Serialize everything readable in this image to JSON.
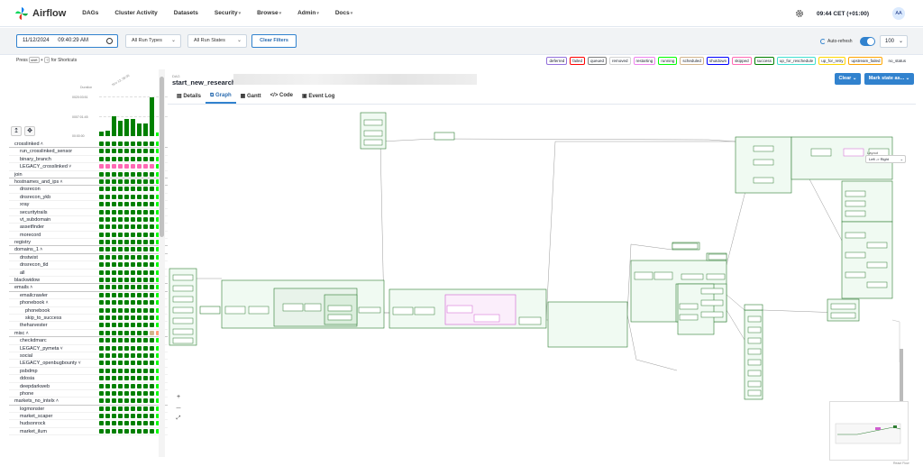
{
  "nav": {
    "brand": "Airflow",
    "items": [
      {
        "label": "DAGs",
        "caret": false
      },
      {
        "label": "Cluster Activity",
        "caret": false
      },
      {
        "label": "Datasets",
        "caret": false
      },
      {
        "label": "Security",
        "caret": true
      },
      {
        "label": "Browse",
        "caret": true
      },
      {
        "label": "Admin",
        "caret": true
      },
      {
        "label": "Docs",
        "caret": true
      }
    ],
    "time": "09:44 CET (+01:00)",
    "user_initials": "AA"
  },
  "filters": {
    "date_value": "11/12/2024",
    "time_value": "09:40:29 AM",
    "run_types": "All Run Types",
    "run_states": "All Run States",
    "clear_label": "Clear Filters",
    "autorefresh_label": "Auto-refresh",
    "autorefresh_on": true,
    "num_runs": "100"
  },
  "shortcuts": {
    "press": "Press",
    "keys": [
      "shift",
      "?"
    ],
    "suffix": "for Shortcuts"
  },
  "legend": [
    {
      "label": "deferred",
      "color": "#9370db"
    },
    {
      "label": "failed",
      "color": "#ff0000"
    },
    {
      "label": "queued",
      "color": "#808080"
    },
    {
      "label": "removed",
      "color": "#d3d3d3"
    },
    {
      "label": "restarting",
      "color": "#ee82ee"
    },
    {
      "label": "running",
      "color": "#00ff00"
    },
    {
      "label": "scheduled",
      "color": "#d2b48c"
    },
    {
      "label": "shutdown",
      "color": "#0000ff"
    },
    {
      "label": "skipped",
      "color": "#ff69b4"
    },
    {
      "label": "success",
      "color": "#008000"
    },
    {
      "label": "up_for_reschedule",
      "color": "#40e0d0"
    },
    {
      "label": "up_for_retry",
      "color": "#ffd700"
    },
    {
      "label": "upstream_failed",
      "color": "#ffa500"
    },
    {
      "label": "no_status",
      "color": "#ffffff"
    }
  ],
  "grid_chart": {
    "duration_label": "Duration",
    "date_label": "Nov 12, 08:36",
    "axis": [
      "0020:03:51",
      "0007:01:45",
      "00:00:00"
    ],
    "bar_heights": [
      0.1,
      0.12,
      0.45,
      0.35,
      0.4,
      0.4,
      0.3,
      0.3,
      0.9,
      0.08
    ],
    "bar_colors": [
      "#008000",
      "#008000",
      "#008000",
      "#008000",
      "#008000",
      "#008000",
      "#008000",
      "#008000",
      "#008000",
      "#00ff00"
    ]
  },
  "tree": [
    {
      "label": "crosslinked",
      "level": 0,
      "expand": "^",
      "pattern": "g"
    },
    {
      "label": "run_crosslinked_sensor",
      "level": 1,
      "pattern": "g"
    },
    {
      "label": "binary_branch",
      "level": 1,
      "pattern": "g"
    },
    {
      "label": "LEGACY_crosslinked",
      "level": 1,
      "expand": "v",
      "pattern": "p"
    },
    {
      "label": "join",
      "level": 0,
      "pattern": "g"
    },
    {
      "label": "hostnames_and_ips",
      "level": 0,
      "expand": "^",
      "pattern": "g"
    },
    {
      "label": "dnsrecon",
      "level": 1,
      "pattern": "g"
    },
    {
      "label": "dnsrecon_ykb",
      "level": 1,
      "pattern": "g"
    },
    {
      "label": "xray",
      "level": 1,
      "pattern": "g"
    },
    {
      "label": "securitytrails",
      "level": 1,
      "pattern": "g"
    },
    {
      "label": "vt_subdomain",
      "level": 1,
      "pattern": "g"
    },
    {
      "label": "assetfinder",
      "level": 1,
      "pattern": "g"
    },
    {
      "label": "morecord",
      "level": 1,
      "pattern": "g"
    },
    {
      "label": "registry",
      "level": 0,
      "pattern": "g"
    },
    {
      "label": "domains_1",
      "level": 0,
      "expand": "^",
      "pattern": "g"
    },
    {
      "label": "dnstwist",
      "level": 1,
      "pattern": "g"
    },
    {
      "label": "dnsrecon_tld",
      "level": 1,
      "pattern": "g"
    },
    {
      "label": "all",
      "level": 1,
      "pattern": "g"
    },
    {
      "label": "blackwidow",
      "level": 0,
      "pattern": "g"
    },
    {
      "label": "emails",
      "level": 0,
      "expand": "^",
      "pattern": "g"
    },
    {
      "label": "emailcrawler",
      "level": 1,
      "pattern": "g"
    },
    {
      "label": "phonebook",
      "level": 1,
      "expand": "^",
      "pattern": "g"
    },
    {
      "label": "phonebook",
      "level": 2,
      "pattern": "g"
    },
    {
      "label": "skip_to_success",
      "level": 2,
      "pattern": "g"
    },
    {
      "label": "theharvester",
      "level": 1,
      "pattern": "g"
    },
    {
      "label": "misc",
      "level": 0,
      "expand": "^",
      "pattern": "t"
    },
    {
      "label": "checkdmarc",
      "level": 1,
      "pattern": "g"
    },
    {
      "label": "LEGACY_pymeta",
      "level": 1,
      "expand": "v",
      "pattern": "g"
    },
    {
      "label": "social",
      "level": 1,
      "pattern": "g"
    },
    {
      "label": "LEGACY_openbugbounty",
      "level": 1,
      "expand": "v",
      "pattern": "g"
    },
    {
      "label": "psbdmp",
      "level": 1,
      "pattern": "g"
    },
    {
      "label": "ddosia",
      "level": 1,
      "pattern": "g"
    },
    {
      "label": "deepdarkweb",
      "level": 1,
      "pattern": "g"
    },
    {
      "label": "phone",
      "level": 1,
      "pattern": "g"
    },
    {
      "label": "markets_no_intelx",
      "level": 0,
      "expand": "^",
      "pattern": "g"
    },
    {
      "label": "logmonster",
      "level": 1,
      "pattern": "g"
    },
    {
      "label": "market_scaper",
      "level": 1,
      "pattern": "g"
    },
    {
      "label": "hudsonrock",
      "level": 1,
      "pattern": "g"
    },
    {
      "label": "market_ilum",
      "level": 1,
      "pattern": "g"
    }
  ],
  "dag": {
    "label": "DAG",
    "title": "start_new_research",
    "clear_label": "Clear",
    "mark_label": "Mark state as...",
    "tabs": [
      "Details",
      "Graph",
      "Gantt",
      "Code",
      "Event Log"
    ],
    "active_tab": "Graph",
    "layout_label": "Layout",
    "layout_value": "Left -> Right",
    "zoom_in": "+",
    "zoom_out": "—",
    "fit": "⤢",
    "attribution": "React Flow"
  }
}
